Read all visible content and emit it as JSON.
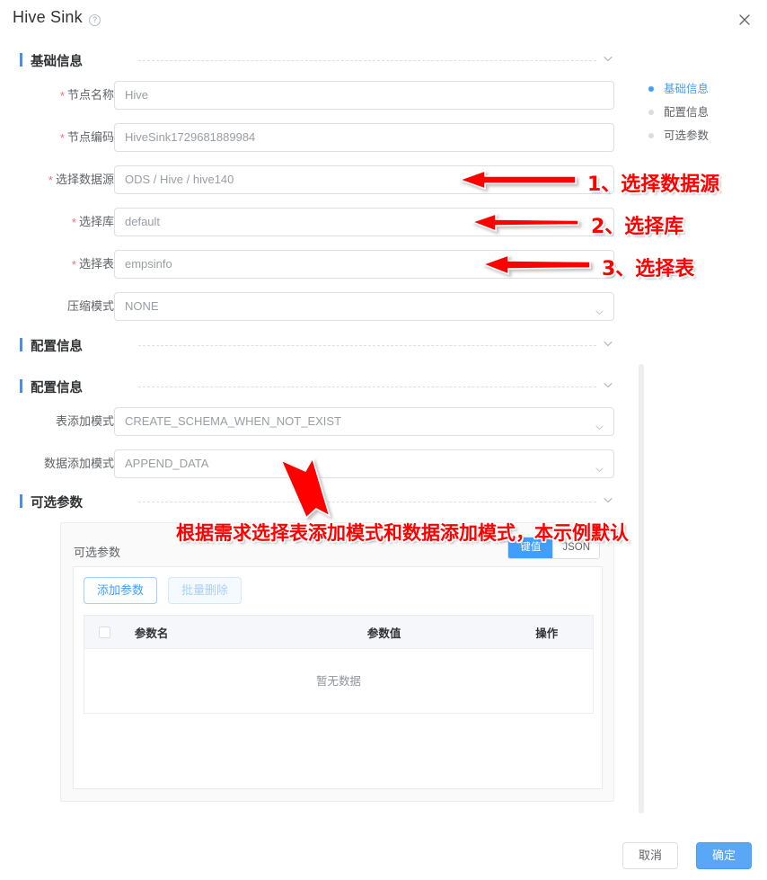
{
  "dialog": {
    "title": "Hive Sink",
    "help_icon": "question-circle-icon",
    "close_icon": "close-icon"
  },
  "anchor_nav": {
    "items": [
      {
        "label": "基础信息",
        "active": true
      },
      {
        "label": "配置信息",
        "active": false
      },
      {
        "label": "可选参数",
        "active": false
      }
    ]
  },
  "sections": {
    "basic": {
      "title": "基础信息"
    },
    "config_a": {
      "title": "配置信息"
    },
    "config_b": {
      "title": "配置信息"
    },
    "optional": {
      "title": "可选参数"
    }
  },
  "form": {
    "basic_fields": [
      {
        "label": "节点名称",
        "required": true,
        "value": "Hive",
        "type": "text"
      },
      {
        "label": "节点编码",
        "required": true,
        "value": "HiveSink1729681889984",
        "type": "text"
      },
      {
        "label": "选择数据源",
        "required": true,
        "value": "ODS / Hive / hive140",
        "type": "select"
      },
      {
        "label": "选择库",
        "required": true,
        "value": "default",
        "type": "select"
      },
      {
        "label": "选择表",
        "required": true,
        "value": "empsinfo",
        "type": "select"
      },
      {
        "label": "压缩模式",
        "required": false,
        "value": "NONE",
        "type": "select"
      }
    ],
    "config_fields": [
      {
        "label": "表添加模式",
        "required": false,
        "value": "CREATE_SCHEMA_WHEN_NOT_EXIST",
        "type": "select"
      },
      {
        "label": "数据添加模式",
        "required": false,
        "value": "APPEND_DATA",
        "type": "select"
      }
    ]
  },
  "optional_params": {
    "card_label": "可选参数",
    "segments": [
      {
        "label": "键值",
        "active": true
      },
      {
        "label": "JSON",
        "active": false
      }
    ],
    "buttons": {
      "add": "添加参数",
      "batch_delete": "批量删除"
    },
    "table": {
      "columns": [
        "",
        "参数名",
        "参数值",
        "操作"
      ],
      "rows": [],
      "empty_text": "暂无数据"
    }
  },
  "footer": {
    "cancel_label": "取消",
    "confirm_label": "确定"
  },
  "annotations": {
    "color": "#ff0000",
    "items": [
      {
        "text": "1、选择数据源"
      },
      {
        "text": "2、选择库"
      },
      {
        "text": "3、选择表"
      },
      {
        "text": "根据需求选择表添加模式和数据添加模式，本示例默认"
      }
    ]
  }
}
